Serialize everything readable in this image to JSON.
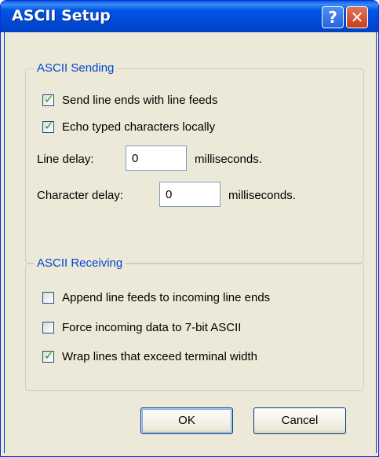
{
  "window": {
    "title": "ASCII Setup",
    "help_symbol": "?",
    "close_symbol": "✕"
  },
  "sending": {
    "title": "ASCII Sending",
    "send_line_ends": {
      "label": "Send line ends with line feeds",
      "checked": true
    },
    "echo_typed": {
      "label": "Echo typed characters locally",
      "checked": true
    },
    "line_delay": {
      "label": "Line delay:",
      "value": "0",
      "unit": "milliseconds."
    },
    "char_delay": {
      "label": "Character delay:",
      "value": "0",
      "unit": "milliseconds."
    }
  },
  "receiving": {
    "title": "ASCII Receiving",
    "append_line_feeds": {
      "label": "Append line feeds to incoming line ends",
      "checked": false
    },
    "force_7bit": {
      "label": "Force incoming data to 7-bit ASCII",
      "checked": false
    },
    "wrap_lines": {
      "label": "Wrap lines that exceed terminal width",
      "checked": true
    }
  },
  "buttons": {
    "ok": "OK",
    "cancel": "Cancel"
  },
  "colors": {
    "titlebar": "#0055e5",
    "group_title": "#0046d5",
    "checkmark": "#21a121",
    "dialog_bg": "#ece9d8"
  },
  "icons": {
    "help": "help-icon",
    "close": "close-icon",
    "check": "checkmark-icon"
  }
}
